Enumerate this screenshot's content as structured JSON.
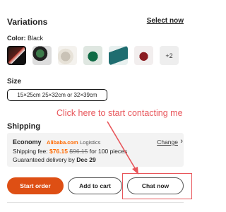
{
  "variations": {
    "title": "Variations",
    "select_now": "Select now",
    "color_label": "Color:",
    "color_value": "Black",
    "swatches": [
      {
        "name": "black-red-bag",
        "selected": true
      },
      {
        "name": "green-black-bag",
        "selected": false
      },
      {
        "name": "white-bag",
        "selected": false
      },
      {
        "name": "green-pouch",
        "selected": false
      },
      {
        "name": "teal-bag",
        "selected": false
      },
      {
        "name": "red-pouch",
        "selected": false
      }
    ],
    "more_count": "+2"
  },
  "size": {
    "title": "Size",
    "option": "15×25cm 25×32cm or 32×39cm"
  },
  "annotation": {
    "text": "Click here to start contacting me",
    "color": "#e8555a"
  },
  "shipping": {
    "title": "Shipping",
    "method": "Economy",
    "provider": "Alibaba.com",
    "provider_suffix": "Logistics",
    "change_label": "Change",
    "fee_label": "Shipping fee:",
    "fee": "$76.15",
    "old_fee": "$96.15",
    "quantity_text": "for 100 pieces",
    "guarantee_label": "Guaranteed delivery by",
    "delivery_date": "Dec 29"
  },
  "actions": {
    "start_order": "Start order",
    "add_to_cart": "Add to cart",
    "chat_now": "Chat now",
    "accent_color": "#de4f14"
  }
}
